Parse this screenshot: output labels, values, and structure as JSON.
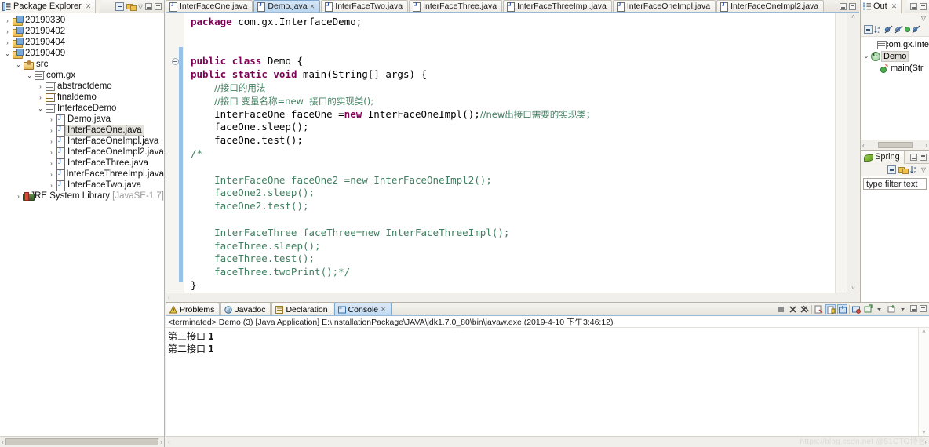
{
  "package_explorer": {
    "tab_label": "Package Explorer",
    "tab_close": "✕",
    "tools": {
      "collapse_all": "collapse-all-icon",
      "link_with_editor": "link-with-editor-icon",
      "view_menu": "▽",
      "minimize": "minimize-icon",
      "maximize": "maximize-icon"
    },
    "tree": [
      {
        "label": "20190330",
        "icon": "project-icon",
        "indent": 0,
        "arrow": "›",
        "selected": false
      },
      {
        "label": "20190402",
        "icon": "project-icon",
        "indent": 0,
        "arrow": "›",
        "selected": false
      },
      {
        "label": "20190404",
        "icon": "project-icon",
        "indent": 0,
        "arrow": "›",
        "selected": false
      },
      {
        "label": "20190409",
        "icon": "project-icon",
        "indent": 0,
        "arrow": "⌄",
        "selected": false
      },
      {
        "label": "src",
        "icon": "source-folder-icon",
        "indent": 1,
        "arrow": "⌄",
        "selected": false
      },
      {
        "label": "com.gx",
        "icon": "package-icon",
        "indent": 2,
        "arrow": "⌄",
        "selected": false
      },
      {
        "label": "abstractdemo",
        "icon": "package-icon",
        "indent": 3,
        "arrow": "›",
        "selected": false
      },
      {
        "label": "finaldemo",
        "icon": "package-icon-brown",
        "indent": 3,
        "arrow": "›",
        "selected": false
      },
      {
        "label": "InterfaceDemo",
        "icon": "package-icon",
        "indent": 3,
        "arrow": "⌄",
        "selected": false
      },
      {
        "label": "Demo.java",
        "icon": "java-file-icon",
        "indent": 4,
        "arrow": "›",
        "selected": false
      },
      {
        "label": "InterFaceOne.java",
        "icon": "java-file-icon",
        "indent": 4,
        "arrow": "›",
        "selected": true
      },
      {
        "label": "InterFaceOneImpl.java",
        "icon": "java-file-icon",
        "indent": 4,
        "arrow": "›",
        "selected": false
      },
      {
        "label": "InterFaceOneImpl2.java",
        "icon": "java-file-icon",
        "indent": 4,
        "arrow": "›",
        "selected": false
      },
      {
        "label": "InterFaceThree.java",
        "icon": "java-file-icon",
        "indent": 4,
        "arrow": "›",
        "selected": false
      },
      {
        "label": "InterFaceThreeImpl.java",
        "icon": "java-file-icon",
        "indent": 4,
        "arrow": "›",
        "selected": false
      },
      {
        "label": "InterFaceTwo.java",
        "icon": "java-file-icon",
        "indent": 4,
        "arrow": "›",
        "selected": false
      },
      {
        "label": "JRE System Library",
        "suffix": " [JavaSE-1.7]",
        "icon": "jre-library-icon",
        "indent": 1,
        "arrow": "›",
        "selected": false
      }
    ],
    "hscroll": {
      "left_arrow": "‹",
      "right_arrow": "›"
    }
  },
  "editor": {
    "tabs": [
      {
        "label": "InterFaceOne.java",
        "active": false,
        "close": ""
      },
      {
        "label": "Demo.java",
        "active": true,
        "close": "✕"
      },
      {
        "label": "InterFaceTwo.java",
        "active": false,
        "close": ""
      },
      {
        "label": "InterFaceThree.java",
        "active": false,
        "close": ""
      },
      {
        "label": "InterFaceThreeImpl.java",
        "active": false,
        "close": ""
      },
      {
        "label": "InterFaceOneImpl.java",
        "active": false,
        "close": ""
      },
      {
        "label": "InterFaceOneImpl2.java",
        "active": false,
        "close": ""
      }
    ],
    "code_lines": [
      {
        "id": "l1",
        "selected": false,
        "parts": [
          {
            "t": "kw",
            "s": "package"
          },
          {
            "t": "pl",
            "s": " com.gx.InterfaceDemo;"
          }
        ]
      },
      {
        "id": "l2",
        "selected": false,
        "parts": []
      },
      {
        "id": "l3",
        "selected": false,
        "parts": []
      },
      {
        "id": "l4",
        "selected": false,
        "parts": [
          {
            "t": "kw",
            "s": "public"
          },
          {
            "t": "pl",
            "s": " "
          },
          {
            "t": "kw",
            "s": "class"
          },
          {
            "t": "pl",
            "s": " Demo {"
          }
        ]
      },
      {
        "id": "l5",
        "selected": false,
        "parts": [
          {
            "t": "kw",
            "s": "public"
          },
          {
            "t": "pl",
            "s": " "
          },
          {
            "t": "kw",
            "s": "static"
          },
          {
            "t": "pl",
            "s": " "
          },
          {
            "t": "kw",
            "s": "void"
          },
          {
            "t": "pl",
            "s": " main(String[] args) {"
          }
        ]
      },
      {
        "id": "l6",
        "selected": false,
        "parts": [
          {
            "t": "pl",
            "s": "    "
          },
          {
            "t": "cn-cm",
            "s": "//接口的用法"
          }
        ]
      },
      {
        "id": "l7",
        "selected": false,
        "parts": [
          {
            "t": "pl",
            "s": "    "
          },
          {
            "t": "cn-cm",
            "s": "//接口 变量名称=new  接口的实现类();"
          }
        ]
      },
      {
        "id": "l8",
        "selected": false,
        "parts": [
          {
            "t": "pl",
            "s": "    InterFaceOne faceOne ="
          },
          {
            "t": "kw",
            "s": "new"
          },
          {
            "t": "pl",
            "s": " InterFaceOneImpl();"
          },
          {
            "t": "cn-cm",
            "s": "//new出接口需要的实现类；"
          }
        ]
      },
      {
        "id": "l9",
        "selected": false,
        "parts": [
          {
            "t": "pl",
            "s": "    faceOne.sleep();"
          }
        ]
      },
      {
        "id": "l10",
        "selected": false,
        "parts": [
          {
            "t": "pl",
            "s": "    faceOne.test();"
          }
        ]
      },
      {
        "id": "l11",
        "selected": false,
        "parts": [
          {
            "t": "cmb",
            "s": "/*"
          }
        ]
      },
      {
        "id": "l12",
        "selected": false,
        "parts": []
      },
      {
        "id": "l13",
        "selected": false,
        "parts": [
          {
            "t": "cmb",
            "s": "    InterFaceOne faceOne2 =new InterFaceOneImpl2();"
          }
        ]
      },
      {
        "id": "l14",
        "selected": false,
        "parts": [
          {
            "t": "cmb",
            "s": "    faceOne2.sleep();"
          }
        ]
      },
      {
        "id": "l15",
        "selected": false,
        "parts": [
          {
            "t": "cmb",
            "s": "    faceOne2.test();"
          }
        ]
      },
      {
        "id": "l16",
        "selected": false,
        "parts": []
      },
      {
        "id": "l17",
        "selected": false,
        "parts": [
          {
            "t": "cmb",
            "s": "    InterFaceThree faceThree=new InterFaceThreeImpl();"
          }
        ]
      },
      {
        "id": "l18",
        "selected": false,
        "parts": [
          {
            "t": "cmb",
            "s": "    faceThree.sleep();"
          }
        ]
      },
      {
        "id": "l19",
        "selected": false,
        "parts": [
          {
            "t": "cmb",
            "s": "    faceThree.test();"
          }
        ]
      },
      {
        "id": "l20",
        "selected": false,
        "parts": [
          {
            "t": "cmb",
            "s": "    faceThree.twoPrint();*/"
          }
        ]
      },
      {
        "id": "l21",
        "selected": false,
        "parts": [
          {
            "t": "pl",
            "s": "}"
          }
        ]
      },
      {
        "id": "l22",
        "selected": true,
        "parts": [
          {
            "t": "pl",
            "s": "}"
          }
        ]
      }
    ],
    "hscroll_left": "‹",
    "scroll_up": "˄",
    "scroll_down": "˅"
  },
  "outline": {
    "tab_label": "Out",
    "tab_close": "✕",
    "view_menu": "▽",
    "toolbar": [
      "collapse-all-icon",
      "sort-icon",
      "hide-fields-icon",
      "hide-static-icon",
      "hide-nonpublic-icon",
      "hide-local-types-icon"
    ],
    "items": [
      {
        "label": "com.gx.Inte",
        "icon": "package-icon",
        "indent": 1,
        "arrow": "",
        "selected": false
      },
      {
        "label": "Demo",
        "icon": "class-icon",
        "indent": 0,
        "arrow": "⌄",
        "selected": true
      },
      {
        "label": "main(Str",
        "icon": "method-icon",
        "indent": 1,
        "arrow": "",
        "selected": false
      }
    ],
    "hscroll": {
      "left_arrow": "‹",
      "right_arrow": "›"
    }
  },
  "spring": {
    "tab_label": "Spring",
    "leaf_icon": "spring-leaf-icon",
    "toolbar": [
      "collapse-all-icon",
      "link-with-editor-icon",
      "sort-icon",
      "view-menu-icon"
    ],
    "view_menu": "▽",
    "filter_placeholder": "type filter text",
    "filter_value": "type filter text"
  },
  "console_panel": {
    "tabs": [
      {
        "label": "Problems",
        "icon": "problems-icon",
        "active": false,
        "close": ""
      },
      {
        "label": "Javadoc",
        "icon": "javadoc-icon",
        "active": false,
        "close": ""
      },
      {
        "label": "Declaration",
        "icon": "declaration-icon",
        "active": false,
        "close": ""
      },
      {
        "label": "Console",
        "icon": "console-icon",
        "active": true,
        "close": "✕"
      }
    ],
    "tools": [
      "terminate-icon",
      "remove-launch-icon",
      "remove-all-terminated-icon",
      "clear-console-icon",
      "scroll-lock-icon",
      "pin-console-icon",
      "display-selected-console-icon",
      "open-console-icon",
      "open-console-dropdown-icon",
      "new-console-view-icon",
      "new-console-dropdown-icon"
    ],
    "status_line": "<terminated> Demo (3) [Java Application] E:\\InstallationPackage\\JAVA\\jdk1.7.0_80\\bin\\javaw.exe (2019-4-10 下午3:46:12)",
    "output_lines": [
      "第二接口 1",
      "第三接口 1"
    ],
    "scroll_up": "˄",
    "scroll_down": "˅",
    "hscroll_left": "‹",
    "hscroll_right": "›",
    "watermark": "https://blog.csdn.net  @51CTO博客"
  },
  "colors": {
    "keyword": "#7f0055",
    "comment": "#3f7f5f",
    "active_tab": "#bcd7ef",
    "selection": "#e8f1fb",
    "change_bar": "#97c1e8",
    "chrome": "#f0f0ee"
  }
}
